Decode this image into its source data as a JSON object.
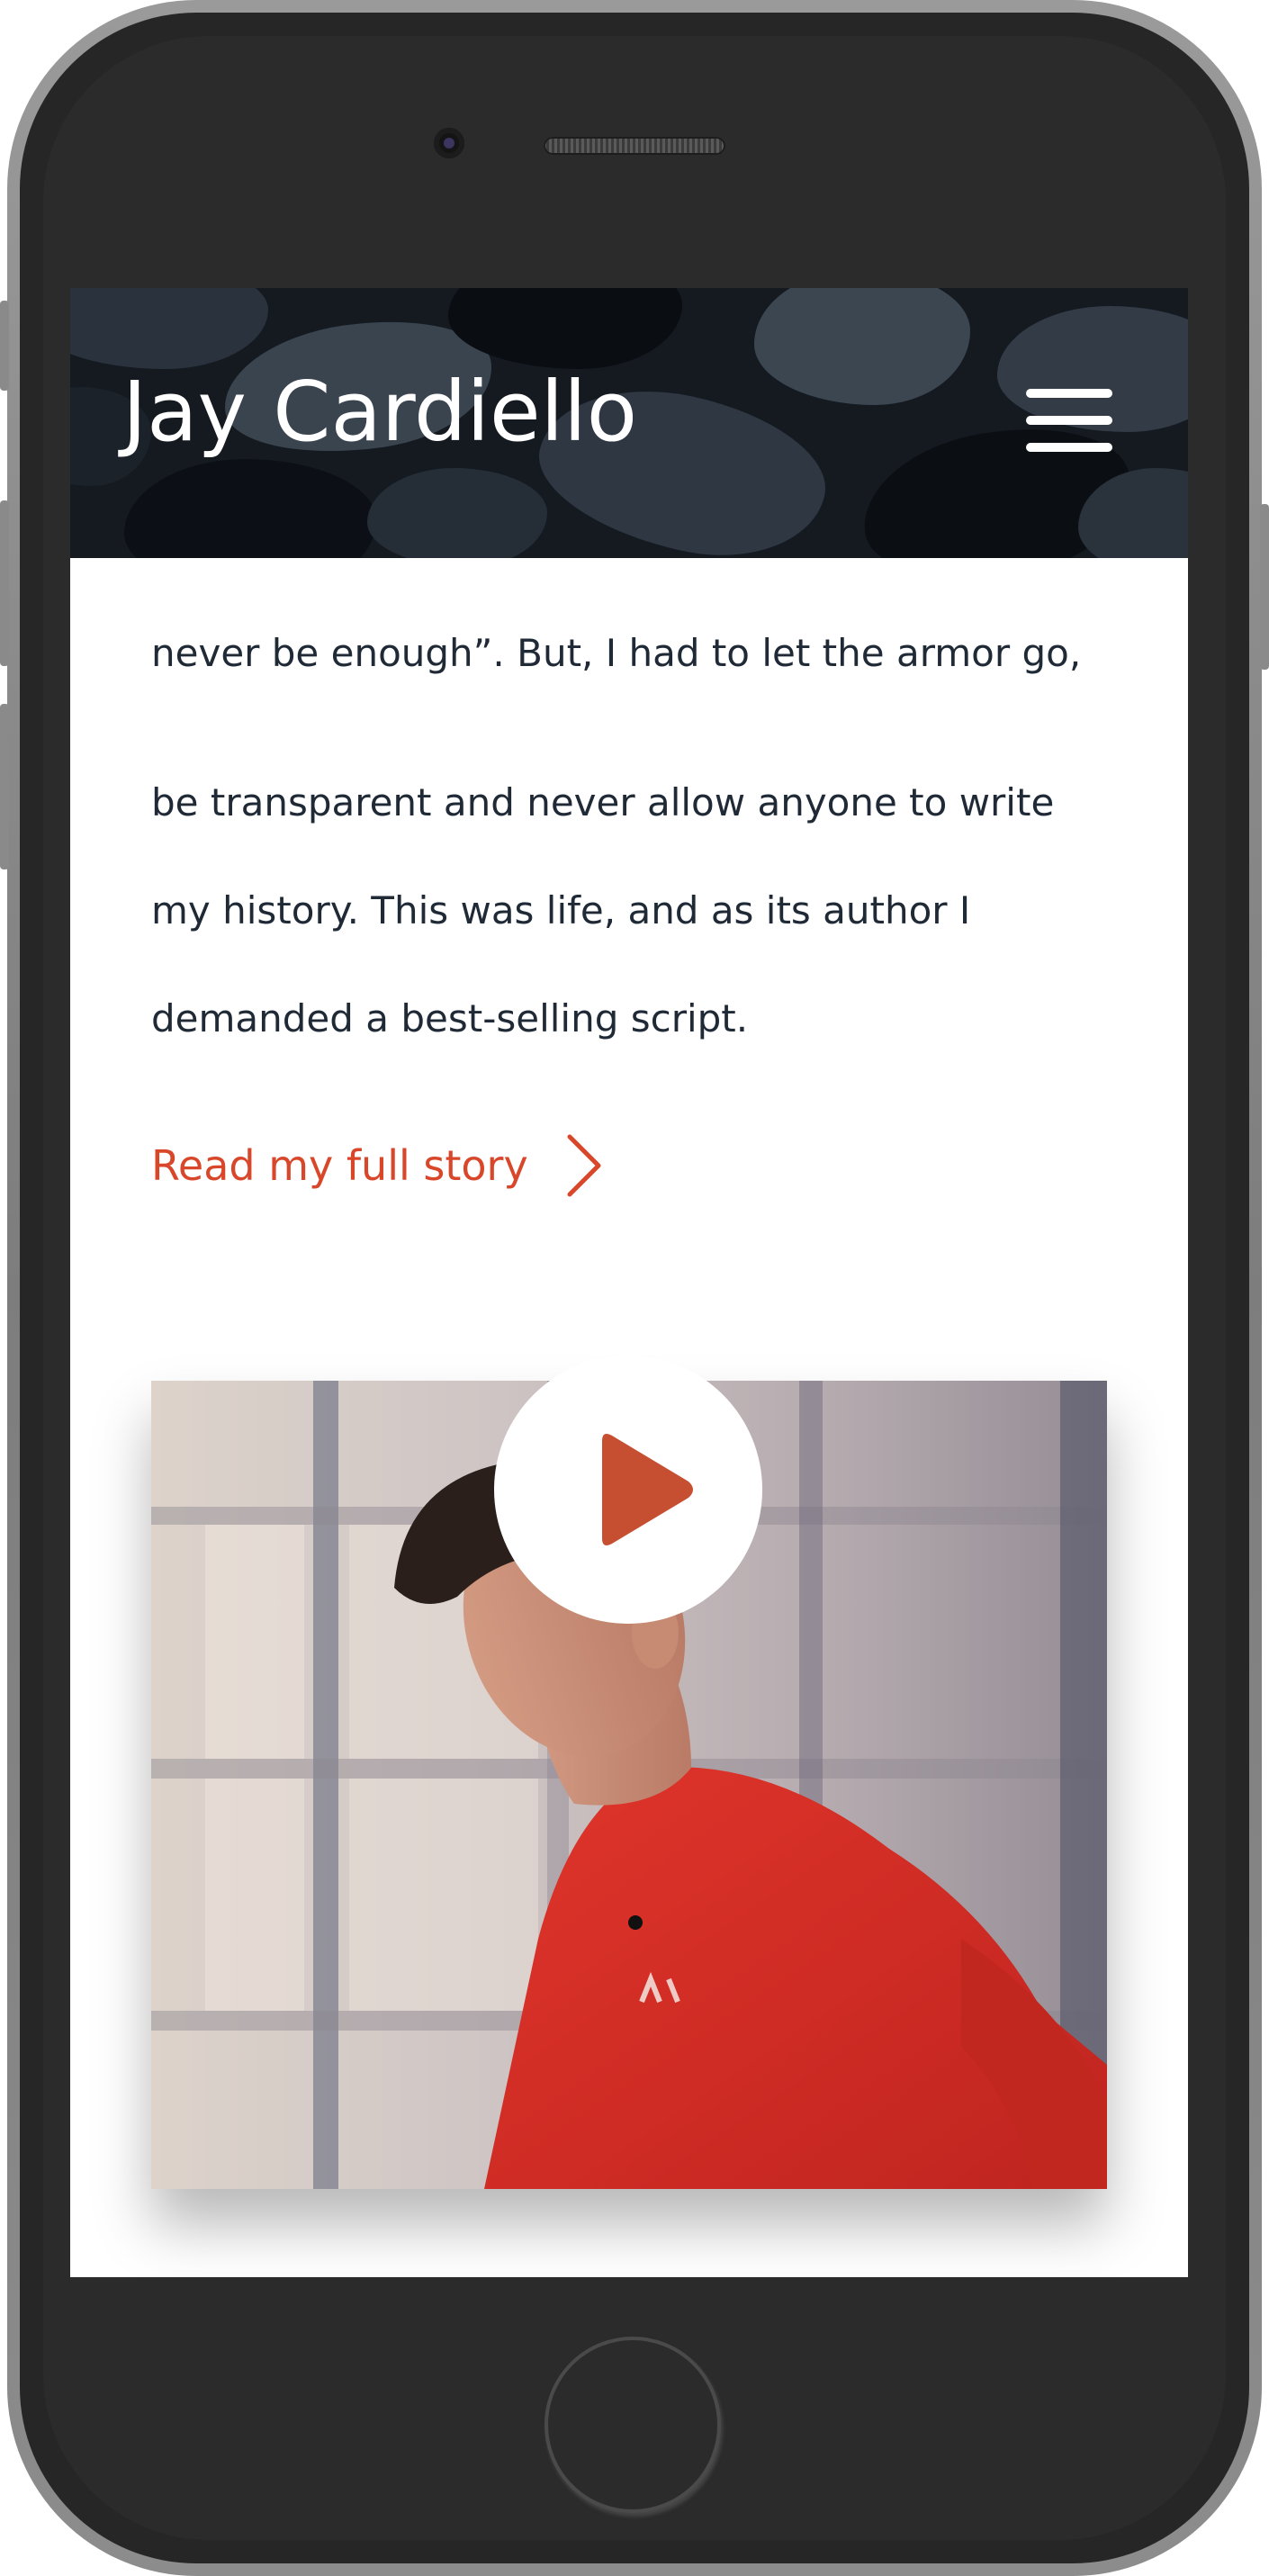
{
  "header": {
    "site_title": "Jay Cardiello",
    "menu_icon": "hamburger-menu-icon"
  },
  "story": {
    "lines": [
      "never be enough”. But, I had to let the armor go,",
      "be transparent and never allow anyone to write",
      "my history. This was life, and as its author I",
      "demanded a best-selling script."
    ],
    "link_label": "Read my full story",
    "link_icon": "chevron-right-icon"
  },
  "video": {
    "play_icon": "play-icon"
  },
  "colors": {
    "accent": "#d9472b",
    "text": "#1f2a36",
    "header_bg": "#151a21",
    "shirt": "#d42a23"
  }
}
